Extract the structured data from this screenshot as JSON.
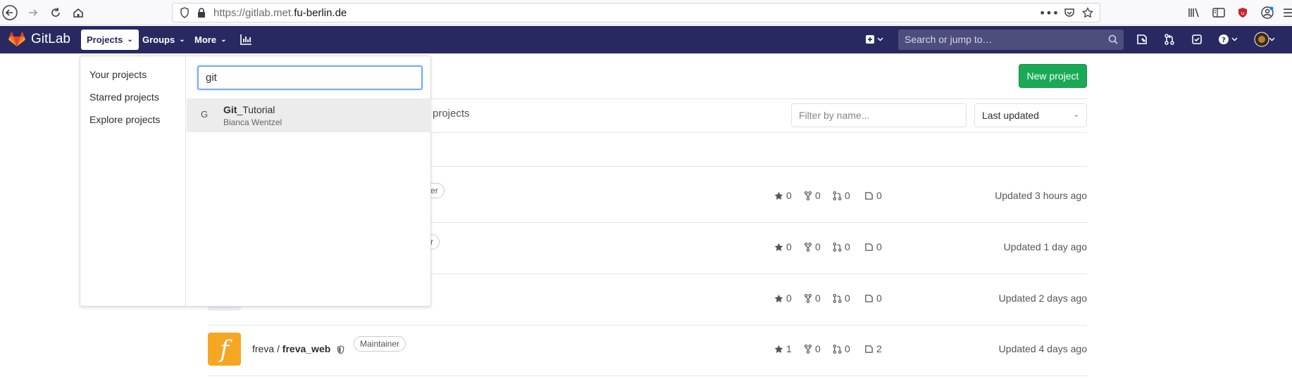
{
  "browser": {
    "url_prefix": "https://gitlab.met.",
    "url_host": "fu-berlin.de"
  },
  "header": {
    "brand": "GitLab",
    "nav": {
      "projects": "Projects",
      "groups": "Groups",
      "more": "More"
    },
    "search_placeholder": "Search or jump to…",
    "colors": {
      "header_bg": "#292961",
      "primary_button": "#1aaa55"
    }
  },
  "page": {
    "new_project_label": "New project",
    "tab_partial": "projects",
    "filter_placeholder": "Filter by name...",
    "sort_selected": "Last updated"
  },
  "projects": [
    {
      "role": "ainer",
      "stars": "0",
      "forks": "0",
      "merge_requests": "0",
      "issues": "0",
      "updated": "Updated 3 hours ago"
    },
    {
      "role": "iner",
      "stars": "0",
      "forks": "0",
      "merge_requests": "0",
      "issues": "0",
      "updated": "Updated 1 day ago"
    },
    {
      "stars": "0",
      "forks": "0",
      "merge_requests": "0",
      "issues": "0",
      "updated": "Updated 2 days ago"
    },
    {
      "namespace": "freva /",
      "name": "freva_web",
      "avatar_letter": "f",
      "role": "Maintainer",
      "stars": "1",
      "forks": "0",
      "merge_requests": "0",
      "issues": "2",
      "updated": "Updated 4 days ago"
    }
  ],
  "dropdown": {
    "links": [
      "Your projects",
      "Starred projects",
      "Explore projects"
    ],
    "search_value": "git",
    "result": {
      "letter": "G",
      "title_match": "Git",
      "title_rest": "_Tutorial",
      "owner": "Bianca Wentzel"
    }
  }
}
